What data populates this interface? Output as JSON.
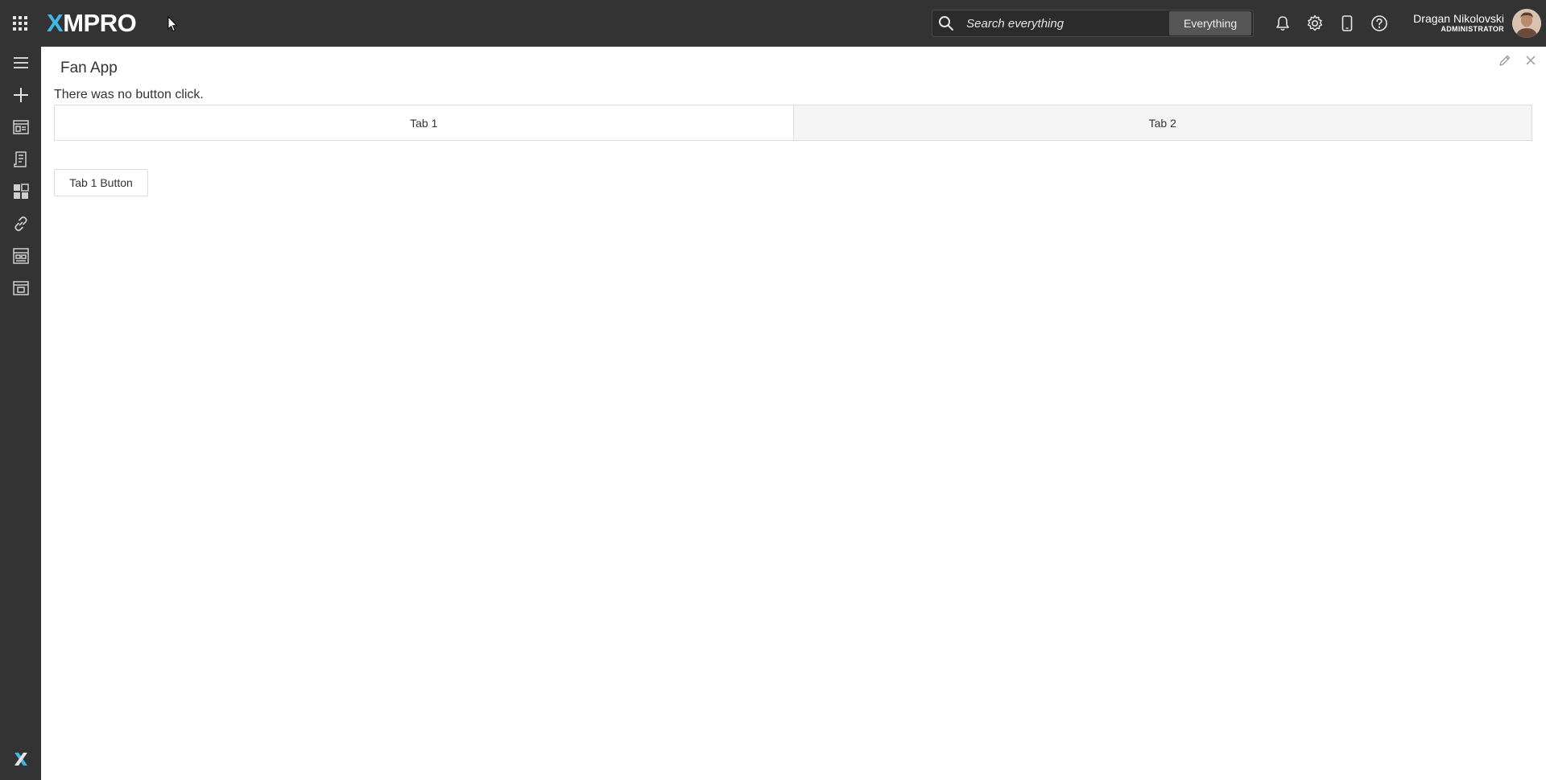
{
  "header": {
    "logo_prefix": "X",
    "logo_suffix": "MPRO",
    "search": {
      "placeholder": "Search everything",
      "scope": "Everything"
    },
    "user": {
      "name": "Dragan Nikolovski",
      "role": "ADMINISTRATOR"
    }
  },
  "icons": {
    "apps": "grid-icon",
    "search": "search-icon",
    "notifications": "bell-icon",
    "settings": "gear-icon",
    "mobile": "mobile-icon",
    "help": "help-icon"
  },
  "sidebar": {
    "items": [
      {
        "icon": "menu-icon"
      },
      {
        "icon": "plus-icon"
      },
      {
        "icon": "data-streams-icon"
      },
      {
        "icon": "recommendations-icon"
      },
      {
        "icon": "apps-icon"
      },
      {
        "icon": "link-icon"
      },
      {
        "icon": "dashboard-icon"
      },
      {
        "icon": "layout-icon"
      }
    ],
    "footer_logo": "X"
  },
  "main": {
    "title": "Fan App",
    "message": "There was no button click.",
    "tabs": [
      {
        "label": "Tab 1",
        "active": true
      },
      {
        "label": "Tab 2",
        "active": false
      }
    ],
    "button_label": "Tab 1 Button"
  },
  "colors": {
    "topbar": "#333333",
    "accent": "#3fb8e8",
    "tab_inactive": "#f5f5f5",
    "border": "#dddddd"
  }
}
